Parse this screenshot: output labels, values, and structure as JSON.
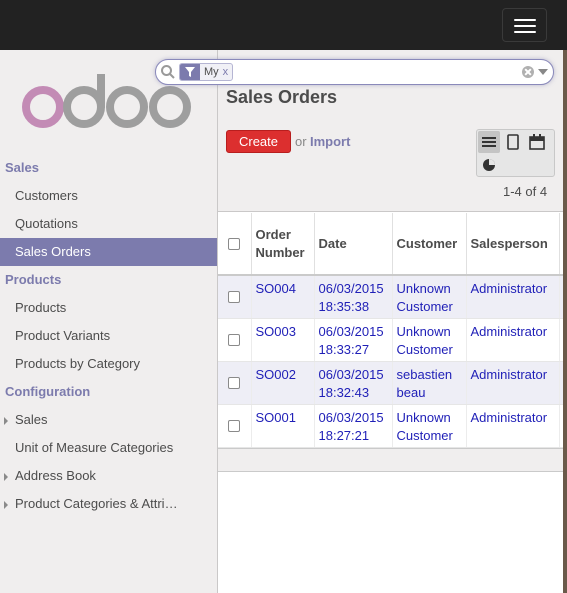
{
  "topbar": {
    "menu_button": "toggle-navigation"
  },
  "search": {
    "facet_label": "My",
    "facet_remove": "x"
  },
  "sidebar": {
    "sections": [
      {
        "heading": "Sales",
        "items": [
          {
            "label": "Customers",
            "active": false,
            "caret": false
          },
          {
            "label": "Quotations",
            "active": false,
            "caret": false
          },
          {
            "label": "Sales Orders",
            "active": true,
            "caret": false
          }
        ]
      },
      {
        "heading": "Products",
        "items": [
          {
            "label": "Products",
            "active": false,
            "caret": false
          },
          {
            "label": "Product Variants",
            "active": false,
            "caret": false
          },
          {
            "label": "Products by Category",
            "active": false,
            "caret": false
          }
        ]
      },
      {
        "heading": "Configuration",
        "items": [
          {
            "label": "Sales",
            "active": false,
            "caret": true
          },
          {
            "label": "Unit of Measure Categories",
            "active": false,
            "caret": false
          },
          {
            "label": "Address Book",
            "active": false,
            "caret": true
          },
          {
            "label": "Product Categories & Attri…",
            "active": false,
            "caret": true
          }
        ]
      }
    ]
  },
  "main": {
    "title": "Sales Orders",
    "create_label": "Create",
    "or_label": "or",
    "import_label": "Import",
    "pager": "1-4 of 4",
    "views": [
      "list-view",
      "kanban-view",
      "calendar-view",
      "graph-view"
    ]
  },
  "table": {
    "headers": {
      "order_line1": "Order",
      "order_line2": "Number",
      "date": "Date",
      "customer": "Customer",
      "salesperson": "Salesperson"
    },
    "rows": [
      {
        "number": "SO004",
        "date": "06/03/2015",
        "time": "18:35:38",
        "customer1": "Unknown",
        "customer2": "Customer",
        "salesperson": "Administrator"
      },
      {
        "number": "SO003",
        "date": "06/03/2015",
        "time": "18:33:27",
        "customer1": "Unknown",
        "customer2": "Customer",
        "salesperson": "Administrator"
      },
      {
        "number": "SO002",
        "date": "06/03/2015",
        "time": "18:32:43",
        "customer1": "sebastien",
        "customer2": "beau",
        "salesperson": "Administrator"
      },
      {
        "number": "SO001",
        "date": "06/03/2015",
        "time": "18:27:21",
        "customer1": "Unknown",
        "customer2": "Customer",
        "salesperson": "Administrator"
      }
    ]
  },
  "colors": {
    "accent": "#7c7bad",
    "create": "#dc2f2f",
    "link": "#1f1fb7",
    "topbar": "#222222"
  }
}
